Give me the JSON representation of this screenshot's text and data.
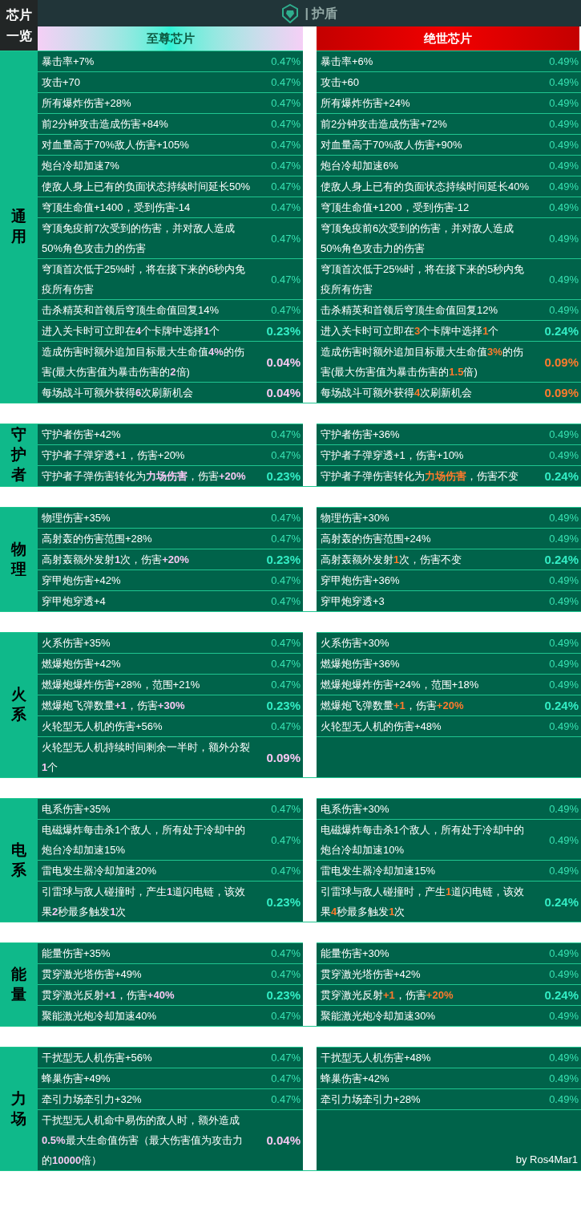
{
  "corner": "芯片一览",
  "header": {
    "title": "| 护盾"
  },
  "columns": [
    {
      "label": "至尊芯片"
    },
    {
      "label": "绝世芯片"
    }
  ],
  "sections": [
    {
      "category": "通用",
      "rows": [
        {
          "left": {
            "text": "暴击率+7%",
            "chance": "0.47%",
            "kind": "common"
          },
          "right": {
            "text": "暴击率+6%",
            "chance": "0.49%",
            "kind": "common"
          }
        },
        {
          "left": {
            "text": "攻击+70",
            "chance": "0.47%",
            "kind": "common"
          },
          "right": {
            "text": "攻击+60",
            "chance": "0.49%",
            "kind": "common"
          }
        },
        {
          "left": {
            "text": "所有爆炸伤害+28%",
            "chance": "0.47%",
            "kind": "common"
          },
          "right": {
            "text": "所有爆炸伤害+24%",
            "chance": "0.49%",
            "kind": "common"
          }
        },
        {
          "left": {
            "text": "前2分钟攻击造成伤害+84%",
            "chance": "0.47%",
            "kind": "common"
          },
          "right": {
            "text": "前2分钟攻击造成伤害+72%",
            "chance": "0.49%",
            "kind": "common"
          }
        },
        {
          "left": {
            "text": "对血量高于70%敌人伤害+105%",
            "chance": "0.47%",
            "kind": "common"
          },
          "right": {
            "text": "对血量高于70%敌人伤害+90%",
            "chance": "0.49%",
            "kind": "common"
          }
        },
        {
          "left": {
            "text": "炮台冷却加速7%",
            "chance": "0.47%",
            "kind": "common"
          },
          "right": {
            "text": "炮台冷却加速6%",
            "chance": "0.49%",
            "kind": "common"
          }
        },
        {
          "left": {
            "text": "使敌人身上已有的负面状态持续时间延长50%",
            "chance": "0.47%",
            "kind": "common"
          },
          "right": {
            "text": "使敌人身上已有的负面状态持续时间延长40%",
            "chance": "0.49%",
            "kind": "common"
          }
        },
        {
          "left": {
            "text": "穹顶生命值+1400，受到伤害-14",
            "chance": "0.47%",
            "kind": "common"
          },
          "right": {
            "text": "穹顶生命值+1200，受到伤害-12",
            "chance": "0.49%",
            "kind": "common"
          }
        },
        {
          "left": {
            "text": "穹顶免疫前7次受到的伤害，并对敌人造成50%角色攻击力的伤害",
            "chance": "0.47%",
            "kind": "common"
          },
          "right": {
            "text": "穹顶免疫前6次受到的伤害，并对敌人造成50%角色攻击力的伤害",
            "chance": "0.49%",
            "kind": "common"
          }
        },
        {
          "left": {
            "text": "穹顶首次低于25%时，将在接下来的6秒内免疫所有伤害",
            "chance": "0.47%",
            "kind": "common"
          },
          "right": {
            "text": "穹顶首次低于25%时，将在接下来的5秒内免疫所有伤害",
            "chance": "0.49%",
            "kind": "common"
          }
        },
        {
          "left": {
            "text": "击杀精英和首领后穹顶生命值回复14%",
            "chance": "0.47%",
            "kind": "common"
          },
          "right": {
            "text": "击杀精英和首领后穹顶生命值回复12%",
            "chance": "0.49%",
            "kind": "common"
          }
        },
        {
          "left": {
            "text": "进入关卡时可立即在**4**个卡牌中选择**1**个",
            "chance": "0.23%",
            "kind": "rare"
          },
          "right": {
            "text": "进入关卡时可立即在**3**个卡牌中选择**1**个",
            "chance": "0.24%",
            "kind": "rare"
          }
        },
        {
          "left": {
            "text": "造成伤害时额外追加目标最大生命值**4%**的伤害(最大伤害值为暴击伤害的**2**倍)",
            "chance": "0.04%",
            "kind": "epic"
          },
          "right": {
            "text": "造成伤害时额外追加目标最大生命值**3%**的伤害(最大伤害值为暴击伤害的**1.5**倍)",
            "chance": "0.09%",
            "kind": "epic"
          }
        },
        {
          "left": {
            "text": "每场战斗可额外获得**6**次刷新机会",
            "chance": "0.04%",
            "kind": "epic"
          },
          "right": {
            "text": "每场战斗可额外获得**4**次刷新机会",
            "chance": "0.09%",
            "kind": "epic"
          }
        }
      ]
    },
    {
      "category": "守护者",
      "rows": [
        {
          "left": {
            "text": "守护者伤害+42%",
            "chance": "0.47%",
            "kind": "common"
          },
          "right": {
            "text": "守护者伤害+36%",
            "chance": "0.49%",
            "kind": "common"
          }
        },
        {
          "left": {
            "text": "守护者子弹穿透+1，伤害+20%",
            "chance": "0.47%",
            "kind": "common"
          },
          "right": {
            "text": "守护者子弹穿透+1，伤害+10%",
            "chance": "0.49%",
            "kind": "common"
          }
        },
        {
          "left": {
            "text": "守护者子弹伤害转化为**力场伤害**，伤害**+20%**",
            "chance": "0.23%",
            "kind": "rare"
          },
          "right": {
            "text": "守护者子弹伤害转化为**力场伤害**，伤害不变",
            "chance": "0.24%",
            "kind": "rare"
          }
        }
      ]
    },
    {
      "category": "物理",
      "rows": [
        {
          "left": {
            "text": "物理伤害+35%",
            "chance": "0.47%",
            "kind": "common"
          },
          "right": {
            "text": "物理伤害+30%",
            "chance": "0.49%",
            "kind": "common"
          }
        },
        {
          "left": {
            "text": "高射轰的伤害范围+28%",
            "chance": "0.47%",
            "kind": "common"
          },
          "right": {
            "text": "高射轰的伤害范围+24%",
            "chance": "0.49%",
            "kind": "common"
          }
        },
        {
          "left": {
            "text": "高射轰额外发射**1**次，伤害**+20%**",
            "chance": "0.23%",
            "kind": "rare"
          },
          "right": {
            "text": "高射轰额外发射**1**次，伤害不变",
            "chance": "0.24%",
            "kind": "rare"
          }
        },
        {
          "left": {
            "text": "穿甲炮伤害+42%",
            "chance": "0.47%",
            "kind": "common"
          },
          "right": {
            "text": "穿甲炮伤害+36%",
            "chance": "0.49%",
            "kind": "common"
          }
        },
        {
          "left": {
            "text": "穿甲炮穿透+4",
            "chance": "0.47%",
            "kind": "common"
          },
          "right": {
            "text": "穿甲炮穿透+3",
            "chance": "0.49%",
            "kind": "common"
          }
        }
      ]
    },
    {
      "category": "火系",
      "rows": [
        {
          "left": {
            "text": "火系伤害+35%",
            "chance": "0.47%",
            "kind": "common"
          },
          "right": {
            "text": "火系伤害+30%",
            "chance": "0.49%",
            "kind": "common"
          }
        },
        {
          "left": {
            "text": "燃爆炮伤害+42%",
            "chance": "0.47%",
            "kind": "common"
          },
          "right": {
            "text": "燃爆炮伤害+36%",
            "chance": "0.49%",
            "kind": "common"
          }
        },
        {
          "left": {
            "text": "燃爆炮爆炸伤害+28%，范围+21%",
            "chance": "0.47%",
            "kind": "common"
          },
          "right": {
            "text": "燃爆炮爆炸伤害+24%，范围+18%",
            "chance": "0.49%",
            "kind": "common"
          }
        },
        {
          "left": {
            "text": "燃爆炮飞弹数量**+1**，伤害**+30%**",
            "chance": "0.23%",
            "kind": "rare"
          },
          "right": {
            "text": "燃爆炮飞弹数量**+1**，伤害**+20%**",
            "chance": "0.24%",
            "kind": "rare"
          }
        },
        {
          "left": {
            "text": "火轮型无人机的伤害+56%",
            "chance": "0.47%",
            "kind": "common"
          },
          "right": {
            "text": "火轮型无人机的伤害+48%",
            "chance": "0.49%",
            "kind": "common"
          }
        },
        {
          "left": {
            "text": "火轮型无人机持续时间剩余一半时，额外分裂**1**个",
            "chance": "0.09%",
            "kind": "epic"
          },
          "right": null
        }
      ]
    },
    {
      "category": "电系",
      "rows": [
        {
          "left": {
            "text": "电系伤害+35%",
            "chance": "0.47%",
            "kind": "common"
          },
          "right": {
            "text": "电系伤害+30%",
            "chance": "0.49%",
            "kind": "common"
          }
        },
        {
          "left": {
            "text": "电磁爆炸每击杀1个敌人，所有处于冷却中的炮台冷却加速15%",
            "chance": "0.47%",
            "kind": "common"
          },
          "right": {
            "text": "电磁爆炸每击杀1个敌人，所有处于冷却中的炮台冷却加速10%",
            "chance": "0.49%",
            "kind": "common"
          }
        },
        {
          "left": {
            "text": "雷电发生器冷却加速20%",
            "chance": "0.47%",
            "kind": "common"
          },
          "right": {
            "text": "雷电发生器冷却加速15%",
            "chance": "0.49%",
            "kind": "common"
          }
        },
        {
          "left": {
            "text": "引雷球与敌人碰撞时，产生**1**道闪电链，该效果**2**秒最多触发**1**次",
            "chance": "0.23%",
            "kind": "rare"
          },
          "right": {
            "text": "引雷球与敌人碰撞时，产生**1**道闪电链，该效果**4**秒最多触发**1**次",
            "chance": "0.24%",
            "kind": "rare"
          }
        }
      ]
    },
    {
      "category": "能量",
      "rows": [
        {
          "left": {
            "text": "能量伤害+35%",
            "chance": "0.47%",
            "kind": "common"
          },
          "right": {
            "text": "能量伤害+30%",
            "chance": "0.49%",
            "kind": "common"
          }
        },
        {
          "left": {
            "text": "贯穿激光塔伤害+49%",
            "chance": "0.47%",
            "kind": "common"
          },
          "right": {
            "text": "贯穿激光塔伤害+42%",
            "chance": "0.49%",
            "kind": "common"
          }
        },
        {
          "left": {
            "text": "贯穿激光反射**+1**，伤害**+40%**",
            "chance": "0.23%",
            "kind": "rare"
          },
          "right": {
            "text": "贯穿激光反射**+1**，伤害**+20%**",
            "chance": "0.24%",
            "kind": "rare"
          }
        },
        {
          "left": {
            "text": "聚能激光炮冷却加速40%",
            "chance": "0.47%",
            "kind": "common"
          },
          "right": {
            "text": "聚能激光炮冷却加速30%",
            "chance": "0.49%",
            "kind": "common"
          }
        }
      ]
    },
    {
      "category": "力场",
      "rows": [
        {
          "left": {
            "text": "干扰型无人机伤害+56%",
            "chance": "0.47%",
            "kind": "common"
          },
          "right": {
            "text": "干扰型无人机伤害+48%",
            "chance": "0.49%",
            "kind": "common"
          }
        },
        {
          "left": {
            "text": "蜂巢伤害+49%",
            "chance": "0.47%",
            "kind": "common"
          },
          "right": {
            "text": "蜂巢伤害+42%",
            "chance": "0.49%",
            "kind": "common"
          }
        },
        {
          "left": {
            "text": "牵引力场牵引力+32%",
            "chance": "0.47%",
            "kind": "common"
          },
          "right": {
            "text": "牵引力场牵引力+28%",
            "chance": "0.49%",
            "kind": "common"
          }
        },
        {
          "left": {
            "text": "干扰型无人机命中易伤的敌人时，额外造成**0.5%**最大生命值伤害（最大伤害值为攻击力的**10000**倍）",
            "chance": "0.04%",
            "kind": "epic"
          },
          "right": null
        }
      ]
    }
  ],
  "credit": "by Ros4Mar1"
}
